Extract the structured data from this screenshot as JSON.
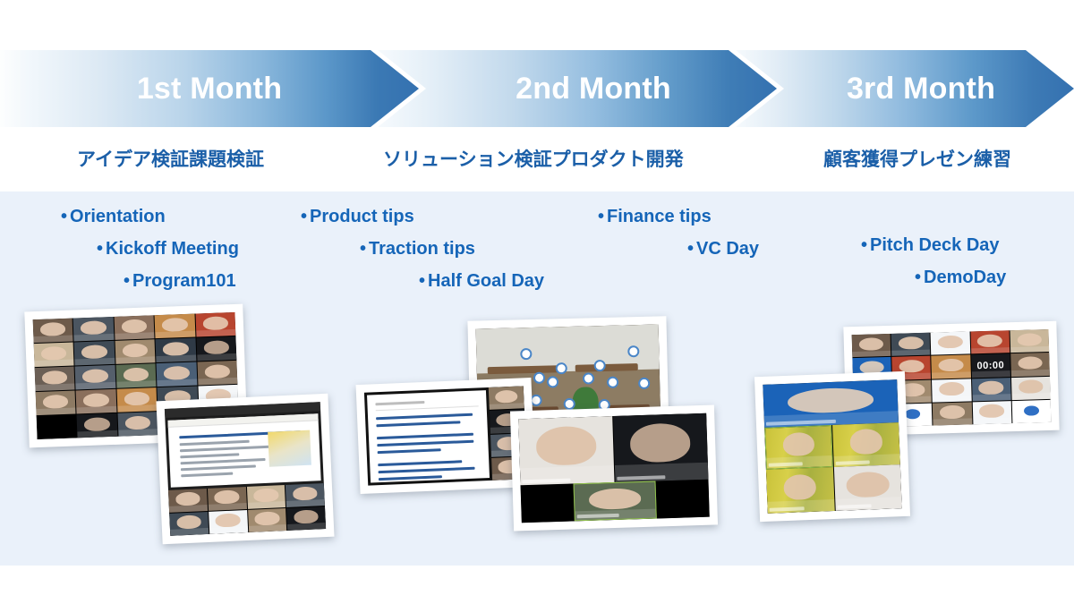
{
  "timeline": {
    "phases": [
      {
        "id": "month-1",
        "heading": "1st Month",
        "subtitle": "アイデア検証課題検証",
        "bullet_groups": [
          {
            "id": "group-1",
            "items": [
              "Orientation",
              "Kickoff Meeting",
              "Program101"
            ]
          }
        ]
      },
      {
        "id": "month-2",
        "heading": "2nd Month",
        "subtitle": "ソリューション検証プロダクト開発",
        "bullet_groups": [
          {
            "id": "group-2",
            "items": [
              "Product tips",
              "Traction tips",
              "Half Goal Day"
            ]
          },
          {
            "id": "group-3",
            "items": [
              "Finance tips",
              "VC Day"
            ]
          }
        ]
      },
      {
        "id": "month-3",
        "heading": "3rd Month",
        "subtitle": "顧客獲得プレゼン練習",
        "bullet_groups": [
          {
            "id": "group-4",
            "items": [
              "Pitch Deck Day",
              "DemoDay"
            ]
          }
        ]
      }
    ],
    "bullet_marker": "•"
  },
  "photos": {
    "month_1": [
      {
        "id": "photo-zoom-grid-waving",
        "caption": "Zoom gallery view of participants waving"
      },
      {
        "id": "photo-scrum-slide-call",
        "caption": "Screen share of scrum tools slide with participants"
      }
    ],
    "month_2": [
      {
        "id": "photo-gather-virtual-office",
        "caption": "Gather virtual office map with avatars"
      },
      {
        "id": "photo-interview-slide",
        "caption": "Slide of customer interview questions in Japanese"
      },
      {
        "id": "photo-three-person-call",
        "caption": "Three person video call"
      }
    ],
    "month_3": [
      {
        "id": "photo-zoom-grid-timer",
        "caption": "Zoom gallery view with 00:00 countdown timer"
      },
      {
        "id": "photo-zoom-grid-bamboo",
        "caption": "Zoom call with bamboo-path virtual backgrounds"
      }
    ],
    "timer_label": "00:00"
  },
  "colors": {
    "chevron_solid": "#3471b0",
    "chevron_gradient_start": "#fdfefe",
    "panel_background": "#eaf1fa",
    "heading_text": "#ffffff",
    "subtitle_text": "#1b5fa8",
    "bullet_text": "#1565b8",
    "page_background": "#ffffff"
  }
}
